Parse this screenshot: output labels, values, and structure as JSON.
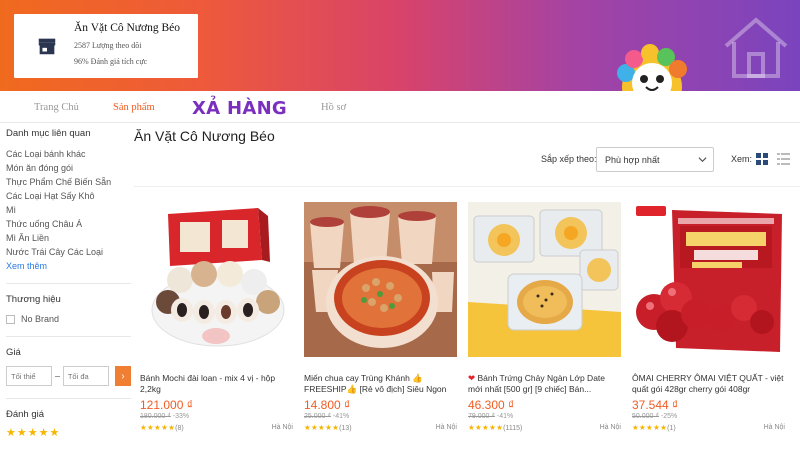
{
  "shop": {
    "name": "Ăn Vặt Cô Nương Béo",
    "followers": "2587 Lượng theo dõi",
    "rating": "96% Đánh giá tích cực"
  },
  "nav": {
    "items": [
      "Trang Chủ",
      "Sản phẩm",
      "Hồ sơ"
    ],
    "active_index": 1,
    "promo": "XẢ HÀNG"
  },
  "sidebar": {
    "category_title": "Danh mục liên quan",
    "categories": [
      "Các Loại bánh khác",
      "Món ăn đóng gói",
      "Thực Phẩm Chế Biến Sẵn",
      "Các Loại Hạt Sấy Khô",
      "Mì",
      "Thức uống Châu Á",
      "Mì Ăn Liền",
      "Nước Trái Cây Các Loại"
    ],
    "more": "Xem thêm",
    "brand_title": "Thương hiệu",
    "brand_option": "No Brand",
    "price_title": "Giá",
    "price_min_placeholder": "Tối thiể",
    "price_max_placeholder": "Tối đa",
    "price_go": "›",
    "rating_title": "Đánh giá",
    "rating_stars": "★★★★★"
  },
  "main": {
    "title": "Ăn Vặt Cô Nương Béo",
    "sort_label": "Sắp xếp theo:",
    "sort_value": "Phù hợp nhất",
    "view_label": "Xem:"
  },
  "products": [
    {
      "name": "Bánh Mochi đài loan - mix 4 vị - hộp 2,2kg",
      "price": "121.000 ₫",
      "old_price": "180.000 ₫",
      "discount": "-33%",
      "stars": "★★★★★",
      "reviews": "(8)",
      "location": "Hà Nội"
    },
    {
      "name": "Miến chua cay Trùng Khánh 👍 FREESHIP👍 [Rẻ vô địch] Siêu Ngon",
      "price": "14.800 ₫",
      "old_price": "25.000 ₫",
      "discount": "-41%",
      "stars": "★★★★★",
      "reviews": "(13)",
      "location": "Hà Nội"
    },
    {
      "name": "Bánh Trứng Chảy Ngàn Lớp Date mới nhất [500 gr] [9 chiếc] Bán...",
      "price": "46.300 ₫",
      "old_price": "79.000 ₫",
      "discount": "-41%",
      "stars": "★★★★★",
      "reviews": "(1115)",
      "location": "Hà Nội"
    },
    {
      "name": "ÔMAI CHERRY ÔMAI VIỆT QUẤT - việt quất gói 428gr cherry gói 408gr",
      "price": "37.544 ₫",
      "old_price": "50.000 ₫",
      "discount": "-25%",
      "stars": "★★★★★",
      "reviews": "(1)",
      "location": "Hà Nội"
    }
  ],
  "colors": {
    "accent": "#f05d23",
    "promo": "#7b2fbe",
    "star": "#f7b500",
    "link": "#2a7ae2"
  }
}
